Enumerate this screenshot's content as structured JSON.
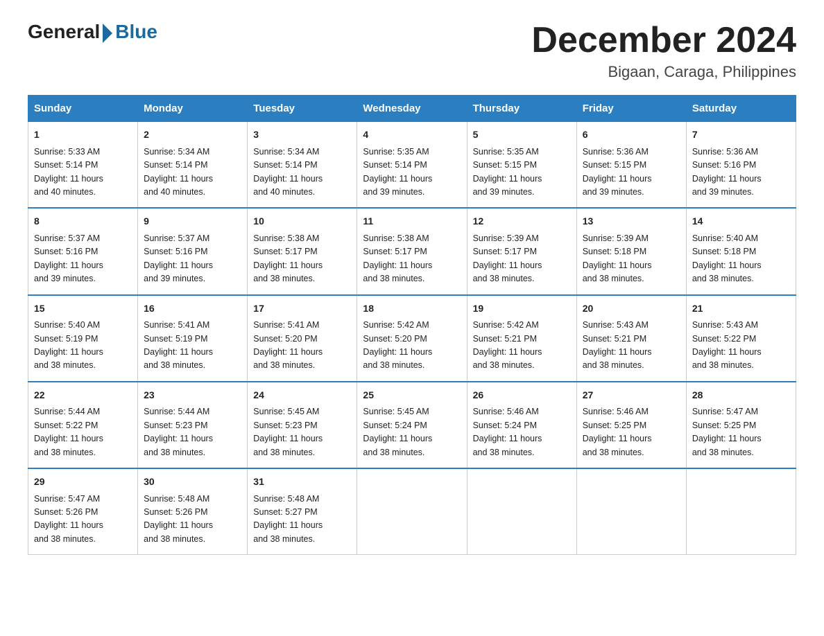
{
  "logo": {
    "general": "General",
    "blue": "Blue",
    "arrow_color": "#1a6aa0"
  },
  "title": {
    "month_year": "December 2024",
    "location": "Bigaan, Caraga, Philippines"
  },
  "days_of_week": [
    "Sunday",
    "Monday",
    "Tuesday",
    "Wednesday",
    "Thursday",
    "Friday",
    "Saturday"
  ],
  "weeks": [
    [
      {
        "day": "1",
        "sunrise": "5:33 AM",
        "sunset": "5:14 PM",
        "daylight": "11 hours and 40 minutes."
      },
      {
        "day": "2",
        "sunrise": "5:34 AM",
        "sunset": "5:14 PM",
        "daylight": "11 hours and 40 minutes."
      },
      {
        "day": "3",
        "sunrise": "5:34 AM",
        "sunset": "5:14 PM",
        "daylight": "11 hours and 40 minutes."
      },
      {
        "day": "4",
        "sunrise": "5:35 AM",
        "sunset": "5:14 PM",
        "daylight": "11 hours and 39 minutes."
      },
      {
        "day": "5",
        "sunrise": "5:35 AM",
        "sunset": "5:15 PM",
        "daylight": "11 hours and 39 minutes."
      },
      {
        "day": "6",
        "sunrise": "5:36 AM",
        "sunset": "5:15 PM",
        "daylight": "11 hours and 39 minutes."
      },
      {
        "day": "7",
        "sunrise": "5:36 AM",
        "sunset": "5:16 PM",
        "daylight": "11 hours and 39 minutes."
      }
    ],
    [
      {
        "day": "8",
        "sunrise": "5:37 AM",
        "sunset": "5:16 PM",
        "daylight": "11 hours and 39 minutes."
      },
      {
        "day": "9",
        "sunrise": "5:37 AM",
        "sunset": "5:16 PM",
        "daylight": "11 hours and 39 minutes."
      },
      {
        "day": "10",
        "sunrise": "5:38 AM",
        "sunset": "5:17 PM",
        "daylight": "11 hours and 38 minutes."
      },
      {
        "day": "11",
        "sunrise": "5:38 AM",
        "sunset": "5:17 PM",
        "daylight": "11 hours and 38 minutes."
      },
      {
        "day": "12",
        "sunrise": "5:39 AM",
        "sunset": "5:17 PM",
        "daylight": "11 hours and 38 minutes."
      },
      {
        "day": "13",
        "sunrise": "5:39 AM",
        "sunset": "5:18 PM",
        "daylight": "11 hours and 38 minutes."
      },
      {
        "day": "14",
        "sunrise": "5:40 AM",
        "sunset": "5:18 PM",
        "daylight": "11 hours and 38 minutes."
      }
    ],
    [
      {
        "day": "15",
        "sunrise": "5:40 AM",
        "sunset": "5:19 PM",
        "daylight": "11 hours and 38 minutes."
      },
      {
        "day": "16",
        "sunrise": "5:41 AM",
        "sunset": "5:19 PM",
        "daylight": "11 hours and 38 minutes."
      },
      {
        "day": "17",
        "sunrise": "5:41 AM",
        "sunset": "5:20 PM",
        "daylight": "11 hours and 38 minutes."
      },
      {
        "day": "18",
        "sunrise": "5:42 AM",
        "sunset": "5:20 PM",
        "daylight": "11 hours and 38 minutes."
      },
      {
        "day": "19",
        "sunrise": "5:42 AM",
        "sunset": "5:21 PM",
        "daylight": "11 hours and 38 minutes."
      },
      {
        "day": "20",
        "sunrise": "5:43 AM",
        "sunset": "5:21 PM",
        "daylight": "11 hours and 38 minutes."
      },
      {
        "day": "21",
        "sunrise": "5:43 AM",
        "sunset": "5:22 PM",
        "daylight": "11 hours and 38 minutes."
      }
    ],
    [
      {
        "day": "22",
        "sunrise": "5:44 AM",
        "sunset": "5:22 PM",
        "daylight": "11 hours and 38 minutes."
      },
      {
        "day": "23",
        "sunrise": "5:44 AM",
        "sunset": "5:23 PM",
        "daylight": "11 hours and 38 minutes."
      },
      {
        "day": "24",
        "sunrise": "5:45 AM",
        "sunset": "5:23 PM",
        "daylight": "11 hours and 38 minutes."
      },
      {
        "day": "25",
        "sunrise": "5:45 AM",
        "sunset": "5:24 PM",
        "daylight": "11 hours and 38 minutes."
      },
      {
        "day": "26",
        "sunrise": "5:46 AM",
        "sunset": "5:24 PM",
        "daylight": "11 hours and 38 minutes."
      },
      {
        "day": "27",
        "sunrise": "5:46 AM",
        "sunset": "5:25 PM",
        "daylight": "11 hours and 38 minutes."
      },
      {
        "day": "28",
        "sunrise": "5:47 AM",
        "sunset": "5:25 PM",
        "daylight": "11 hours and 38 minutes."
      }
    ],
    [
      {
        "day": "29",
        "sunrise": "5:47 AM",
        "sunset": "5:26 PM",
        "daylight": "11 hours and 38 minutes."
      },
      {
        "day": "30",
        "sunrise": "5:48 AM",
        "sunset": "5:26 PM",
        "daylight": "11 hours and 38 minutes."
      },
      {
        "day": "31",
        "sunrise": "5:48 AM",
        "sunset": "5:27 PM",
        "daylight": "11 hours and 38 minutes."
      },
      null,
      null,
      null,
      null
    ]
  ],
  "labels": {
    "sunrise": "Sunrise:",
    "sunset": "Sunset:",
    "daylight": "Daylight:"
  }
}
